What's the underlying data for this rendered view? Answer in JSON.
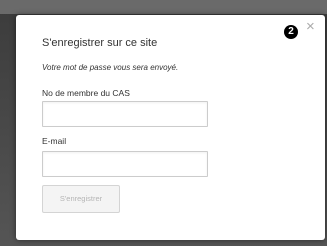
{
  "modal": {
    "title": "S'enregistrer sur ce site",
    "note": "Votre mot de passe vous sera envoyé.",
    "member_label": "No de membre du CAS",
    "member_value": "",
    "email_label": "E-mail",
    "email_value": "",
    "submit_label": "S'enregistrer",
    "close_glyph": "×",
    "step_badge": "2"
  }
}
